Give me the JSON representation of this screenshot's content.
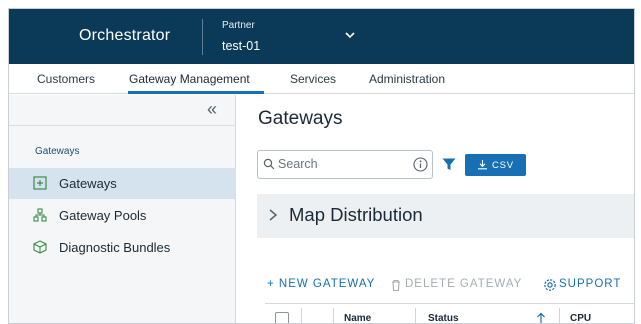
{
  "header": {
    "app_title": "Orchestrator",
    "partner_label": "Partner",
    "partner_value": "test-01"
  },
  "top_nav": {
    "tabs": [
      {
        "label": "Customers"
      },
      {
        "label": "Gateway Management",
        "active": true
      },
      {
        "label": "Services"
      },
      {
        "label": "Administration"
      }
    ]
  },
  "sidebar": {
    "collapse_glyph": "«",
    "section_title": "Gateways",
    "items": [
      {
        "label": "Gateways",
        "icon": "gateway-icon",
        "active": true
      },
      {
        "label": "Gateway Pools",
        "icon": "pool-icon"
      },
      {
        "label": "Diagnostic Bundles",
        "icon": "bundle-icon"
      }
    ]
  },
  "main": {
    "page_title": "Gateways",
    "search": {
      "placeholder": "Search"
    },
    "csv_label": "CSV",
    "accordion_title": "Map Distribution",
    "actions": {
      "new_gateway": "+ NEW GATEWAY",
      "delete_gateway": "DELETE GATEWAY",
      "support": "SUPPORT"
    },
    "columns": [
      "Name",
      "Status",
      "CPU"
    ]
  },
  "colors": {
    "header_bg": "#0b3a58",
    "accent": "#1670b3",
    "sidebar_active": "#d5e3ee"
  }
}
